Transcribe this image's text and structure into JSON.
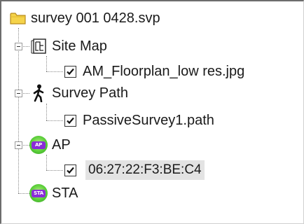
{
  "tree": {
    "root": {
      "label": "survey 001 0428.svp",
      "icon": "folder-icon"
    },
    "nodes": [
      {
        "label": "Site Map",
        "icon": "site-map-icon",
        "children": [
          {
            "label": "AM_Floorplan_low res.jpg",
            "checked": true
          }
        ]
      },
      {
        "label": "Survey Path",
        "icon": "walking-person-icon",
        "children": [
          {
            "label": "PassiveSurvey1.path",
            "checked": true
          }
        ]
      },
      {
        "label": "AP",
        "icon": "ap-badge-icon",
        "badge_text": "AP",
        "children": [
          {
            "label": "06:27:22:F3:BE:C4",
            "checked": true,
            "selected": true
          }
        ]
      },
      {
        "label": "STA",
        "icon": "sta-badge-icon",
        "badge_text": "STA",
        "children": []
      }
    ]
  },
  "colors": {
    "folder": "#f5d34a",
    "badge_green": "#5ccf3a",
    "badge_purple": "#8a2bd8",
    "selection": "#e3e3e3"
  }
}
